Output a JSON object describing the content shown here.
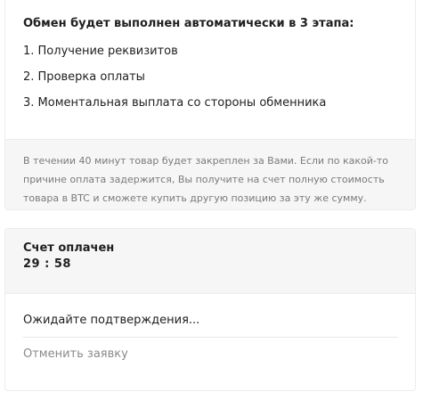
{
  "info": {
    "heading": "Обмен будет выполнен автоматически в 3 этапа:",
    "steps": [
      "1. Получение реквизитов",
      "2. Проверка оплаты",
      "3. Моментальная выплата со стороны обменника"
    ],
    "note": "В течении 40 минут товар будет закреплен за Вами. Если по какой-то причине оплата задержится, Вы получите на счет полную стоимость товара в BTC и сможете купить другую позицию за эту же сумму."
  },
  "status": {
    "title": "Счет оплачен",
    "timer": "29 : 58",
    "waiting": "Ожидайте подтверждения...",
    "cancel_label": "Отменить заявку"
  }
}
